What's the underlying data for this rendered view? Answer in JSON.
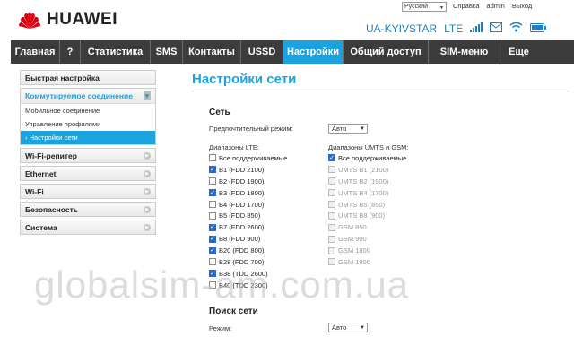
{
  "brand": {
    "name": "HUAWEI",
    "color": "#d7000f"
  },
  "header": {
    "language": "Русский",
    "links": [
      "Справка",
      "admin",
      "Выход"
    ],
    "operator": "UA-KYIVSTAR",
    "network": "LTE"
  },
  "nav": {
    "items": [
      "Главная",
      "?",
      "Статистика",
      "SMS",
      "Контакты",
      "USSD",
      "Настройки",
      "Общий доступ",
      "SIM-меню",
      "Еще"
    ],
    "active": "Настройки",
    "accent": "#1aa3de"
  },
  "sidebar": {
    "quick": "Быстрая настройка",
    "group_title": "Коммутируемое соединение",
    "sub_items": [
      "Мобильное соединение",
      "Управление профилями",
      "Настройки сети"
    ],
    "active_sub": "Настройки сети",
    "items": [
      "Wi-Fi-репитер",
      "Ethernet",
      "Wi-Fi",
      "Безопасность",
      "Система"
    ]
  },
  "main": {
    "title": "Настройки сети",
    "network": {
      "title": "Сеть",
      "preferred_label": "Предпочтительный режим:",
      "preferred_value": "Авто",
      "lte_title": "Диапазоны LTE:",
      "umts_title": "Диапазоны UMTS и GSM:",
      "lte": [
        {
          "label": "Все поддерживаемые",
          "checked": false
        },
        {
          "label": "B1 (FDD 2100)",
          "checked": true
        },
        {
          "label": "B2 (FDD 1900)",
          "checked": false
        },
        {
          "label": "B3 (FDD 1800)",
          "checked": true
        },
        {
          "label": "B4 (FDD 1700)",
          "checked": false
        },
        {
          "label": "B5 (FDD 850)",
          "checked": false
        },
        {
          "label": "B7 (FDD 2600)",
          "checked": true
        },
        {
          "label": "B8 (FDD 900)",
          "checked": true
        },
        {
          "label": "B20 (FDD 800)",
          "checked": true
        },
        {
          "label": "B28 (FDD 700)",
          "checked": false
        },
        {
          "label": "B38 (TDD 2600)",
          "checked": true
        },
        {
          "label": "B40 (TDD 2300)",
          "checked": false
        }
      ],
      "umts": [
        {
          "label": "Все поддерживаемые",
          "checked": true,
          "disabled": false
        },
        {
          "label": "UMTS B1 (2100)",
          "checked": false,
          "disabled": true
        },
        {
          "label": "UMTS B2 (1900)",
          "checked": false,
          "disabled": true
        },
        {
          "label": "UMTS B4 (1700)",
          "checked": false,
          "disabled": true
        },
        {
          "label": "UMTS B5 (850)",
          "checked": false,
          "disabled": true
        },
        {
          "label": "UMTS B8 (900)",
          "checked": false,
          "disabled": true
        },
        {
          "label": "GSM 850",
          "checked": false,
          "disabled": true
        },
        {
          "label": "GSM 900",
          "checked": false,
          "disabled": true
        },
        {
          "label": "GSM 1800",
          "checked": false,
          "disabled": true
        },
        {
          "label": "GSM 1900",
          "checked": false,
          "disabled": true
        }
      ]
    },
    "search": {
      "title": "Поиск сети",
      "mode_label": "Режим:",
      "mode_value": "Авто"
    }
  },
  "watermark": "globalsim-am.com.ua"
}
